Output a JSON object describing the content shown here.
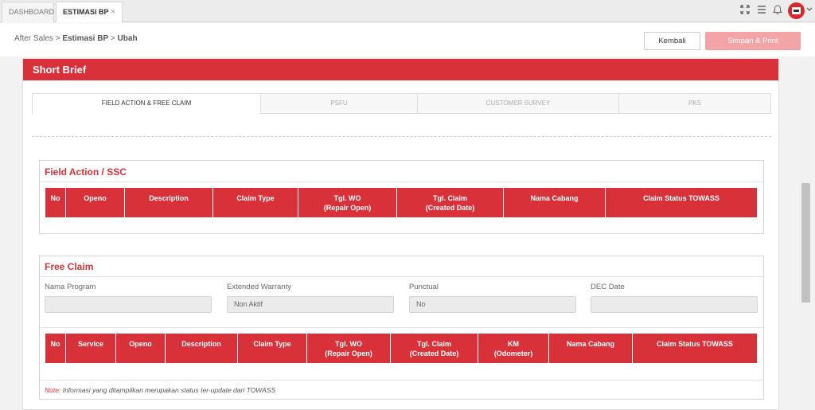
{
  "tabs": [
    {
      "label": "DASHBOARD"
    },
    {
      "label": "ESTIMASI BP",
      "close": "×"
    }
  ],
  "breadcrumb": {
    "root": "After Sales",
    "sep": ">",
    "mid": "Estimasi BP",
    "leaf": "Ubah"
  },
  "actions": {
    "back": "Kembali",
    "save": "Simpan & Print"
  },
  "panel": {
    "title": "Short Brief"
  },
  "inner_tabs": [
    "FIELD ACTION & FREE CLAIM",
    "PSFU",
    "CUSTOMER SURVEY",
    "PKS"
  ],
  "field_action": {
    "title": "Field Action / SSC",
    "columns": [
      "No",
      "Openo",
      "Description",
      "Claim Type",
      "Tgl. WO",
      "(Repair Open)",
      "Tgl. Claim",
      "(Created Date)",
      "Nama Cabang",
      "Claim Status TOWASS"
    ]
  },
  "free_claim": {
    "title": "Free Claim",
    "fields": [
      {
        "label": "Nama Program",
        "value": ""
      },
      {
        "label": "Extended Warranty",
        "value": "Non Aktif"
      },
      {
        "label": "Punctual",
        "value": "No"
      },
      {
        "label": "DEC Date",
        "value": ""
      }
    ],
    "columns": [
      "No",
      "Service",
      "Openo",
      "Description",
      "Claim Type",
      "Tgl. WO",
      "(Repair Open)",
      "Tgl. Claim",
      "(Created Date)",
      "KM",
      "(Odometer)",
      "Nama Cabang",
      "Claim Status TOWASS"
    ],
    "note_label": "Note:",
    "note_text": "Informasi yang ditampilkan merupakan status ter-update dari TOWASS"
  },
  "icons": [
    "fullscreen-icon",
    "menu-icon",
    "bell-icon",
    "avatar-icon",
    "chevron-down-icon"
  ],
  "colors": {
    "accent": "#d8313a",
    "save_disabled": "#f3a4a7"
  }
}
